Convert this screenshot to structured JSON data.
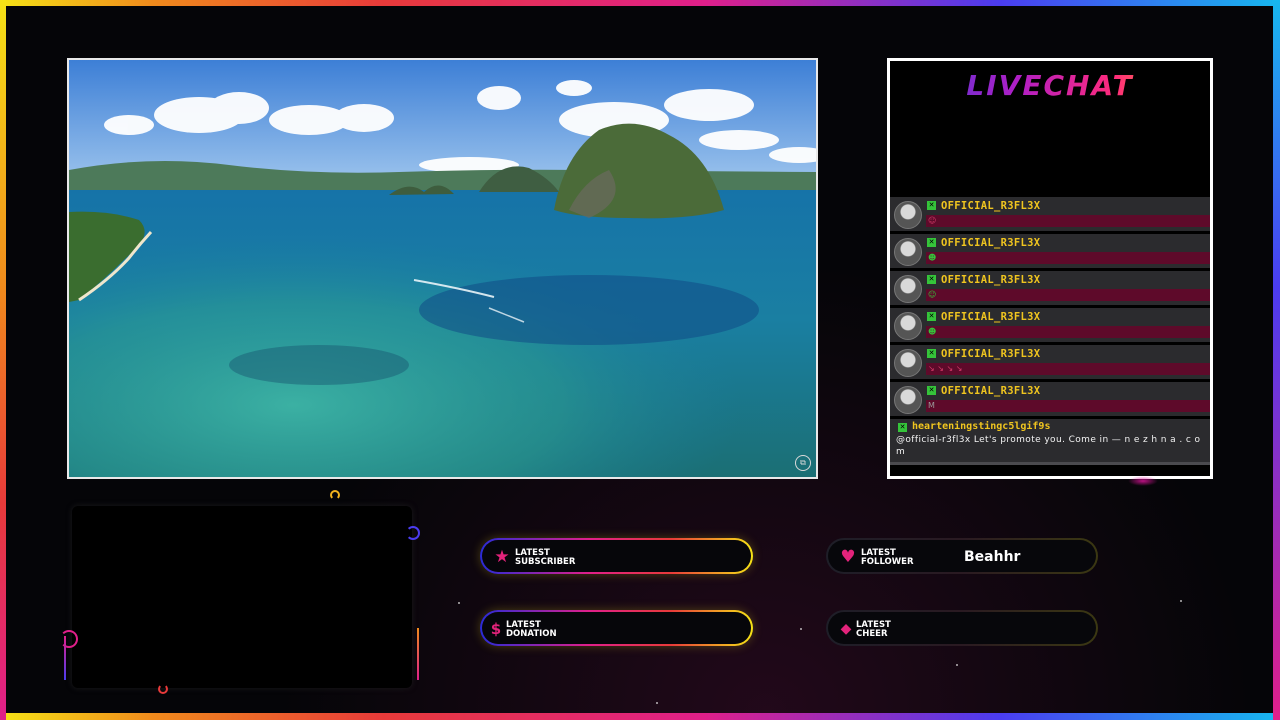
{
  "colors": {
    "accent_pink": "#e3237b",
    "name_yellow": "#f0c51f",
    "frame_gradient": [
      "#f6e316",
      "#e83a3a",
      "#e01f8a",
      "#4b3cf0",
      "#17b8ef"
    ]
  },
  "video": {
    "icon": "capture-icon"
  },
  "chat": {
    "title": "LIVECHAT",
    "messages": [
      {
        "name": "OFFICIAL_R3FL3X",
        "badge": "moderator-badge-icon",
        "emote": "☺"
      },
      {
        "name": "OFFICIAL_R3FL3X",
        "badge": "moderator-badge-icon",
        "emote": "☻"
      },
      {
        "name": "OFFICIAL_R3FL3X",
        "badge": "moderator-badge-icon",
        "emote": "☺"
      },
      {
        "name": "OFFICIAL_R3FL3X",
        "badge": "moderator-badge-icon",
        "emote": "☻"
      },
      {
        "name": "OFFICIAL_R3FL3X",
        "badge": "moderator-badge-icon",
        "emote": "↘ ↘ ↘ ↘"
      },
      {
        "name": "OFFICIAL_R3FL3X",
        "badge": "moderator-badge-icon",
        "emote": "M"
      }
    ],
    "last_message": {
      "name": "hearteningstingc5lgif9s",
      "text": "@official-r3fl3x Let's promote you. Come in — n e z h n a . c o m"
    }
  },
  "alerts": {
    "subscriber": {
      "label_line1": "LATEST",
      "label_line2": "SUBSCRIBER",
      "icon": "star-icon",
      "value": ""
    },
    "follower": {
      "label_line1": "LATEST",
      "label_line2": "FOLLOWER",
      "icon": "heart-icon",
      "value": "Beahhr"
    },
    "donation": {
      "label_line1": "LATEST",
      "label_line2": "DONATION",
      "icon": "dollar-icon",
      "value": ""
    },
    "cheer": {
      "label_line1": "LATEST",
      "label_line2": "CHEER",
      "icon": "diamond-icon",
      "value": ""
    }
  }
}
